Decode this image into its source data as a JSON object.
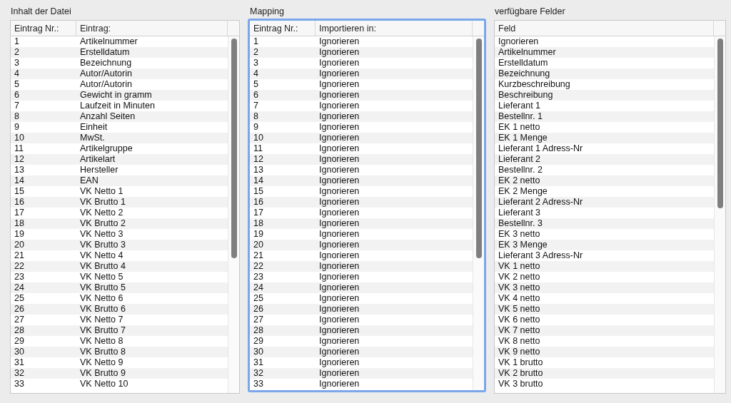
{
  "panels": [
    {
      "title": "Inhalt der Datei",
      "focused": false,
      "columns": [
        "Eintrag Nr.:",
        "Eintrag:"
      ],
      "rows": [
        [
          "1",
          "Artikelnummer"
        ],
        [
          "2",
          "Erstelldatum"
        ],
        [
          "3",
          "Bezeichnung"
        ],
        [
          "4",
          "Autor/Autorin"
        ],
        [
          "5",
          "Autor/Autorin"
        ],
        [
          "6",
          "Gewicht in gramm"
        ],
        [
          "7",
          "Laufzeit in Minuten"
        ],
        [
          "8",
          "Anzahl Seiten"
        ],
        [
          "9",
          "Einheit"
        ],
        [
          "10",
          "MwSt."
        ],
        [
          "11",
          "Artikelgruppe"
        ],
        [
          "12",
          "Artikelart"
        ],
        [
          "13",
          "Hersteller"
        ],
        [
          "14",
          "EAN"
        ],
        [
          "15",
          "VK Netto 1"
        ],
        [
          "16",
          "VK Brutto 1"
        ],
        [
          "17",
          "VK Netto 2"
        ],
        [
          "18",
          "VK Brutto 2"
        ],
        [
          "19",
          "VK Netto 3"
        ],
        [
          "20",
          "VK Brutto 3"
        ],
        [
          "21",
          "VK Netto 4"
        ],
        [
          "22",
          "VK Brutto 4"
        ],
        [
          "23",
          "VK Netto 5"
        ],
        [
          "24",
          "VK Brutto 5"
        ],
        [
          "25",
          "VK Netto 6"
        ],
        [
          "26",
          "VK Brutto 6"
        ],
        [
          "27",
          "VK Netto 7"
        ],
        [
          "28",
          "VK Brutto 7"
        ],
        [
          "29",
          "VK Netto 8"
        ],
        [
          "30",
          "VK Brutto 8"
        ],
        [
          "31",
          "VK Netto 9"
        ],
        [
          "32",
          "VK Brutto 9"
        ],
        [
          "33",
          "VK Netto 10"
        ]
      ]
    },
    {
      "title": "Mapping",
      "focused": true,
      "columns": [
        "Eintrag Nr.:",
        "Importieren in:"
      ],
      "rows": [
        [
          "1",
          "Ignorieren"
        ],
        [
          "2",
          "Ignorieren"
        ],
        [
          "3",
          "Ignorieren"
        ],
        [
          "4",
          "Ignorieren"
        ],
        [
          "5",
          "Ignorieren"
        ],
        [
          "6",
          "Ignorieren"
        ],
        [
          "7",
          "Ignorieren"
        ],
        [
          "8",
          "Ignorieren"
        ],
        [
          "9",
          "Ignorieren"
        ],
        [
          "10",
          "Ignorieren"
        ],
        [
          "11",
          "Ignorieren"
        ],
        [
          "12",
          "Ignorieren"
        ],
        [
          "13",
          "Ignorieren"
        ],
        [
          "14",
          "Ignorieren"
        ],
        [
          "15",
          "Ignorieren"
        ],
        [
          "16",
          "Ignorieren"
        ],
        [
          "17",
          "Ignorieren"
        ],
        [
          "18",
          "Ignorieren"
        ],
        [
          "19",
          "Ignorieren"
        ],
        [
          "20",
          "Ignorieren"
        ],
        [
          "21",
          "Ignorieren"
        ],
        [
          "22",
          "Ignorieren"
        ],
        [
          "23",
          "Ignorieren"
        ],
        [
          "24",
          "Ignorieren"
        ],
        [
          "25",
          "Ignorieren"
        ],
        [
          "26",
          "Ignorieren"
        ],
        [
          "27",
          "Ignorieren"
        ],
        [
          "28",
          "Ignorieren"
        ],
        [
          "29",
          "Ignorieren"
        ],
        [
          "30",
          "Ignorieren"
        ],
        [
          "31",
          "Ignorieren"
        ],
        [
          "32",
          "Ignorieren"
        ],
        [
          "33",
          "Ignorieren"
        ]
      ]
    },
    {
      "title": "verfügbare Felder",
      "focused": false,
      "columns": [
        "Feld"
      ],
      "rows": [
        [
          "Ignorieren"
        ],
        [
          "Artikelnummer"
        ],
        [
          "Erstelldatum"
        ],
        [
          "Bezeichnung"
        ],
        [
          "Kurzbeschreibung"
        ],
        [
          "Beschreibung"
        ],
        [
          "Lieferant 1"
        ],
        [
          "Bestellnr. 1"
        ],
        [
          "EK 1 netto"
        ],
        [
          "EK 1 Menge"
        ],
        [
          "Lieferant 1 Adress-Nr"
        ],
        [
          "Lieferant 2"
        ],
        [
          "Bestellnr. 2"
        ],
        [
          "EK 2 netto"
        ],
        [
          "EK 2 Menge"
        ],
        [
          "Lieferant 2 Adress-Nr"
        ],
        [
          "Lieferant 3"
        ],
        [
          "Bestellnr. 3"
        ],
        [
          "EK 3 netto"
        ],
        [
          "EK 3 Menge"
        ],
        [
          "Lieferant 3 Adress-Nr"
        ],
        [
          "VK 1 netto"
        ],
        [
          "VK 2 netto"
        ],
        [
          "VK 3 netto"
        ],
        [
          "VK 4 netto"
        ],
        [
          "VK 5 netto"
        ],
        [
          "VK 6 netto"
        ],
        [
          "VK 7 netto"
        ],
        [
          "VK 8 netto"
        ],
        [
          "VK 9 netto"
        ],
        [
          "VK 1 brutto"
        ],
        [
          "VK 2 brutto"
        ],
        [
          "VK 3 brutto"
        ]
      ]
    }
  ]
}
